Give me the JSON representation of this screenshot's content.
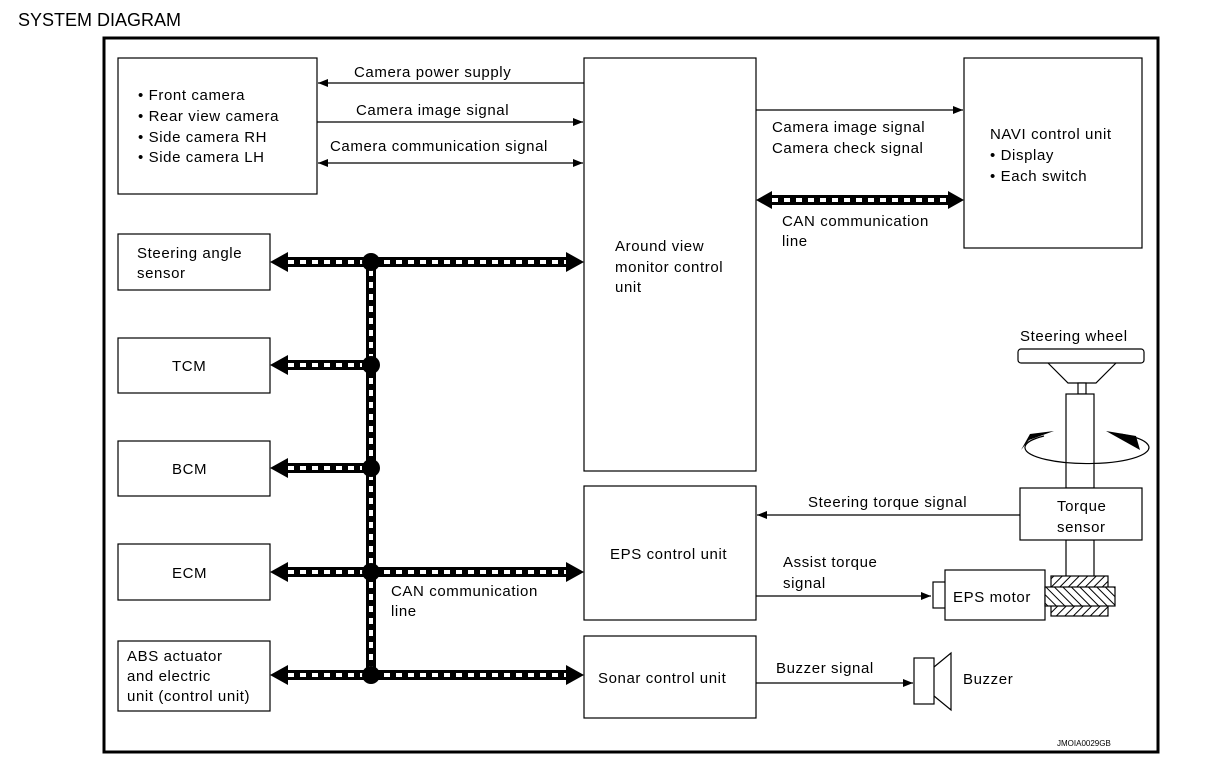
{
  "title": "SYSTEM DIAGRAM",
  "cameras": {
    "items": [
      "• Front camera",
      "• Rear view camera",
      "• Side camera RH",
      "• Side camera LH"
    ]
  },
  "signals": {
    "camera_power": "Camera power supply",
    "camera_image": "Camera image signal",
    "camera_comm": "Camera communication signal",
    "navi_image": "Camera image signal",
    "navi_check": "Camera check signal",
    "can_top": [
      "CAN communication",
      "line"
    ],
    "can_bottom": [
      "CAN communication",
      "line"
    ],
    "steering_torque": "Steering torque signal",
    "assist_torque": [
      "Assist torque",
      "signal"
    ],
    "buzzer_signal": "Buzzer signal"
  },
  "units": {
    "navi": [
      "NAVI control unit",
      "• Display",
      "• Each switch"
    ],
    "avm": [
      "Around view",
      "monitor control",
      "unit"
    ],
    "eps": "EPS control unit",
    "sonar": "Sonar control unit",
    "steering_angle": [
      "Steering angle",
      "sensor"
    ],
    "tcm": "TCM",
    "bcm": "BCM",
    "ecm": "ECM",
    "abs": [
      "ABS actuator",
      "and electric",
      "unit (control unit)"
    ],
    "torque_sensor": [
      "Torque",
      "sensor"
    ],
    "eps_motor": "EPS motor",
    "buzzer": "Buzzer",
    "steering_wheel": "Steering wheel"
  },
  "code": "JMOIA0029GB"
}
